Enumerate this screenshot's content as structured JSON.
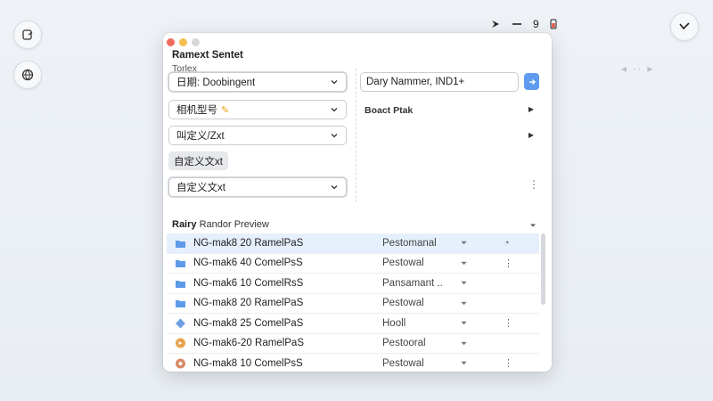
{
  "window": {
    "title": "Ramext Sentet",
    "subtitle": "Torlex"
  },
  "top_icons": {
    "item_label": "9"
  },
  "left_panel": {
    "field1": "日期: Doobingent",
    "field2": "相机型号",
    "field3": "叫定义/Zxt",
    "chip": "自定义文xt",
    "field4": "自定义文xt"
  },
  "right_panel": {
    "search_value": "Dary Nammer, IND1+",
    "label": "Boact Ptak"
  },
  "section": {
    "title_bold": "Rairy",
    "title_rest": " Randor Preview"
  },
  "rows": [
    {
      "name": "NG-mak8 20 RamelPaS",
      "status": "Pestomanal",
      "icon": "folder-icon",
      "color": "#5d9ae8",
      "extra": "◔"
    },
    {
      "name": "NG-mak6 40 ComelPsS",
      "status": "Pestowal",
      "icon": "folder-icon",
      "color": "#5d9ae8",
      "extra": "⋮"
    },
    {
      "name": "NG-mak6 10 ComelRsS",
      "status": "Pansamant ..",
      "icon": "folder-icon",
      "color": "#5d9ae8",
      "extra": ""
    },
    {
      "name": "NG-mak8 20 RamelPaS",
      "status": "Pestowal",
      "icon": "folder-icon",
      "color": "#5d9ae8",
      "extra": ""
    },
    {
      "name": "NG-mak8 25 ComelPaS",
      "status": "Hooll",
      "icon": "diamond-icon",
      "color": "#6f9fe0",
      "extra": "⋮"
    },
    {
      "name": "NG-mak6-20 RamelPaS",
      "status": "Pestooral",
      "icon": "circle-icon",
      "color": "#e7a24d",
      "extra": ""
    },
    {
      "name": "NG-mak8 10 ComelPsS",
      "status": "Pestowal",
      "icon": "gear-icon",
      "color": "#d88a67",
      "extra": "⋮"
    }
  ],
  "colors": {
    "accent": "#5f9cf0",
    "selected_row": "#e6f0fc"
  }
}
